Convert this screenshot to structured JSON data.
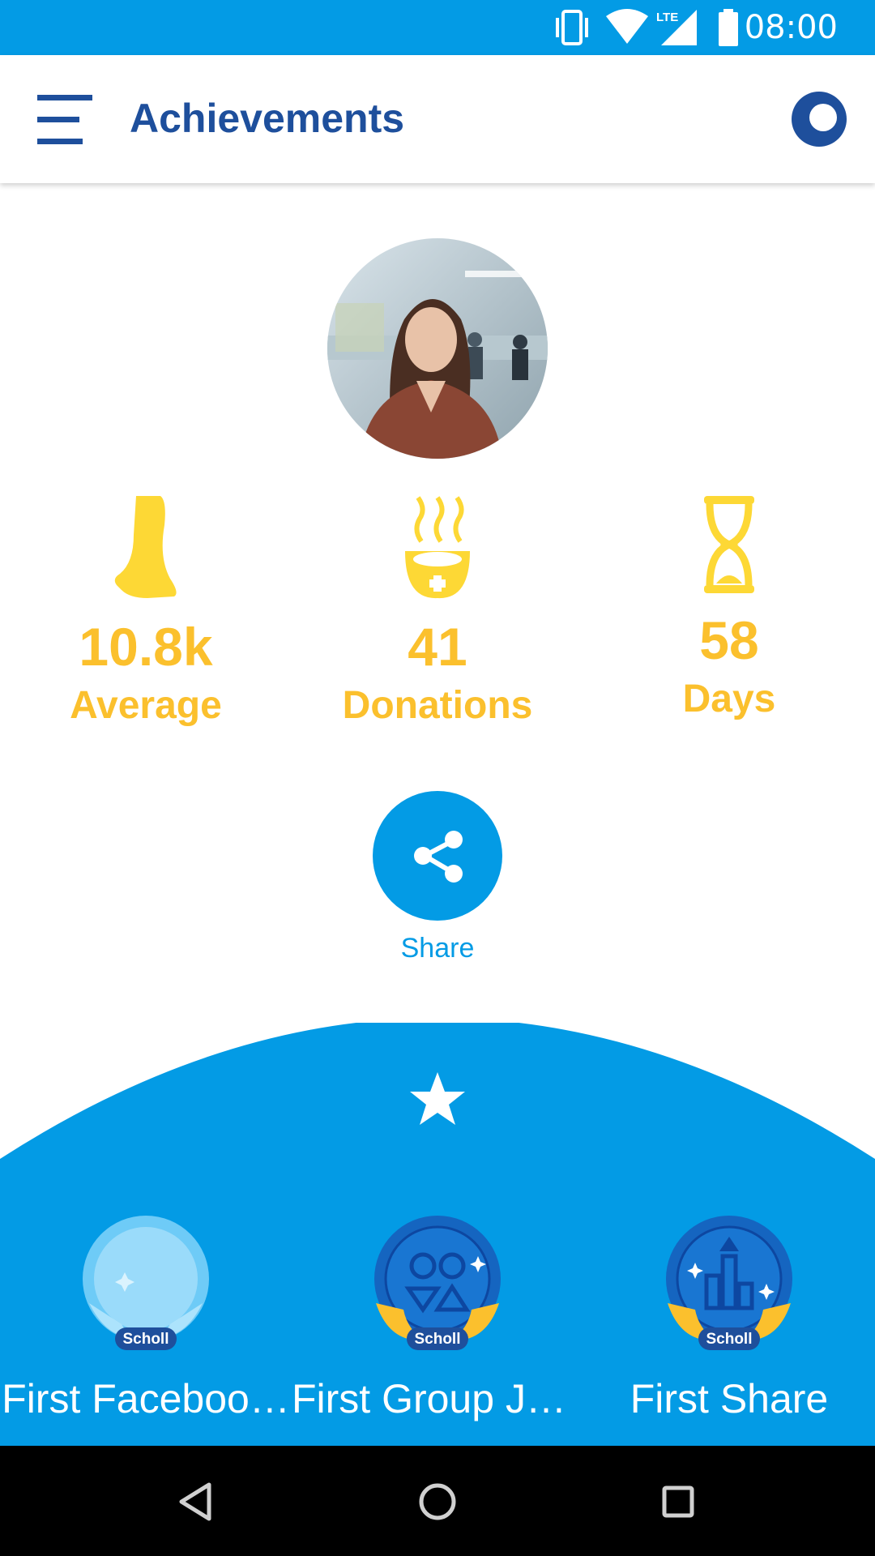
{
  "status_bar": {
    "time": "08:00",
    "icons": [
      "vibrate-icon",
      "wifi-icon",
      "lte-signal-icon",
      "battery-icon"
    ],
    "network_label": "LTE",
    "color": "#039be5"
  },
  "app_bar": {
    "title": "Achievements",
    "menu_icon": "hamburger-menu-icon",
    "right_icon": "ring-progress-icon",
    "title_color": "#1e4f9c"
  },
  "profile": {
    "avatar": "profile-photo"
  },
  "stats": [
    {
      "icon": "foot-icon",
      "value": "10.8k",
      "label": "Average"
    },
    {
      "icon": "donation-bowl-icon",
      "value": "41",
      "label": "Donations"
    },
    {
      "icon": "hourglass-icon",
      "value": "58",
      "label": "Days"
    }
  ],
  "stat_color": "#fbc02d",
  "share": {
    "icon": "share-icon",
    "label": "Share"
  },
  "achievements_panel": {
    "icon": "star-icon",
    "color": "#039be5",
    "badges": [
      {
        "label": "First Faceboo…",
        "badge_text": "Scholl",
        "icon": "first-facebook-badge-icon",
        "unlocked": false
      },
      {
        "label": "First Group Jo…",
        "badge_text": "Scholl",
        "icon": "first-group-join-badge-icon",
        "unlocked": true
      },
      {
        "label": "First Share",
        "badge_text": "Scholl",
        "icon": "first-share-badge-icon",
        "unlocked": true
      }
    ]
  },
  "nav_bar": {
    "buttons": [
      "back-icon",
      "home-icon",
      "recents-icon"
    ]
  }
}
